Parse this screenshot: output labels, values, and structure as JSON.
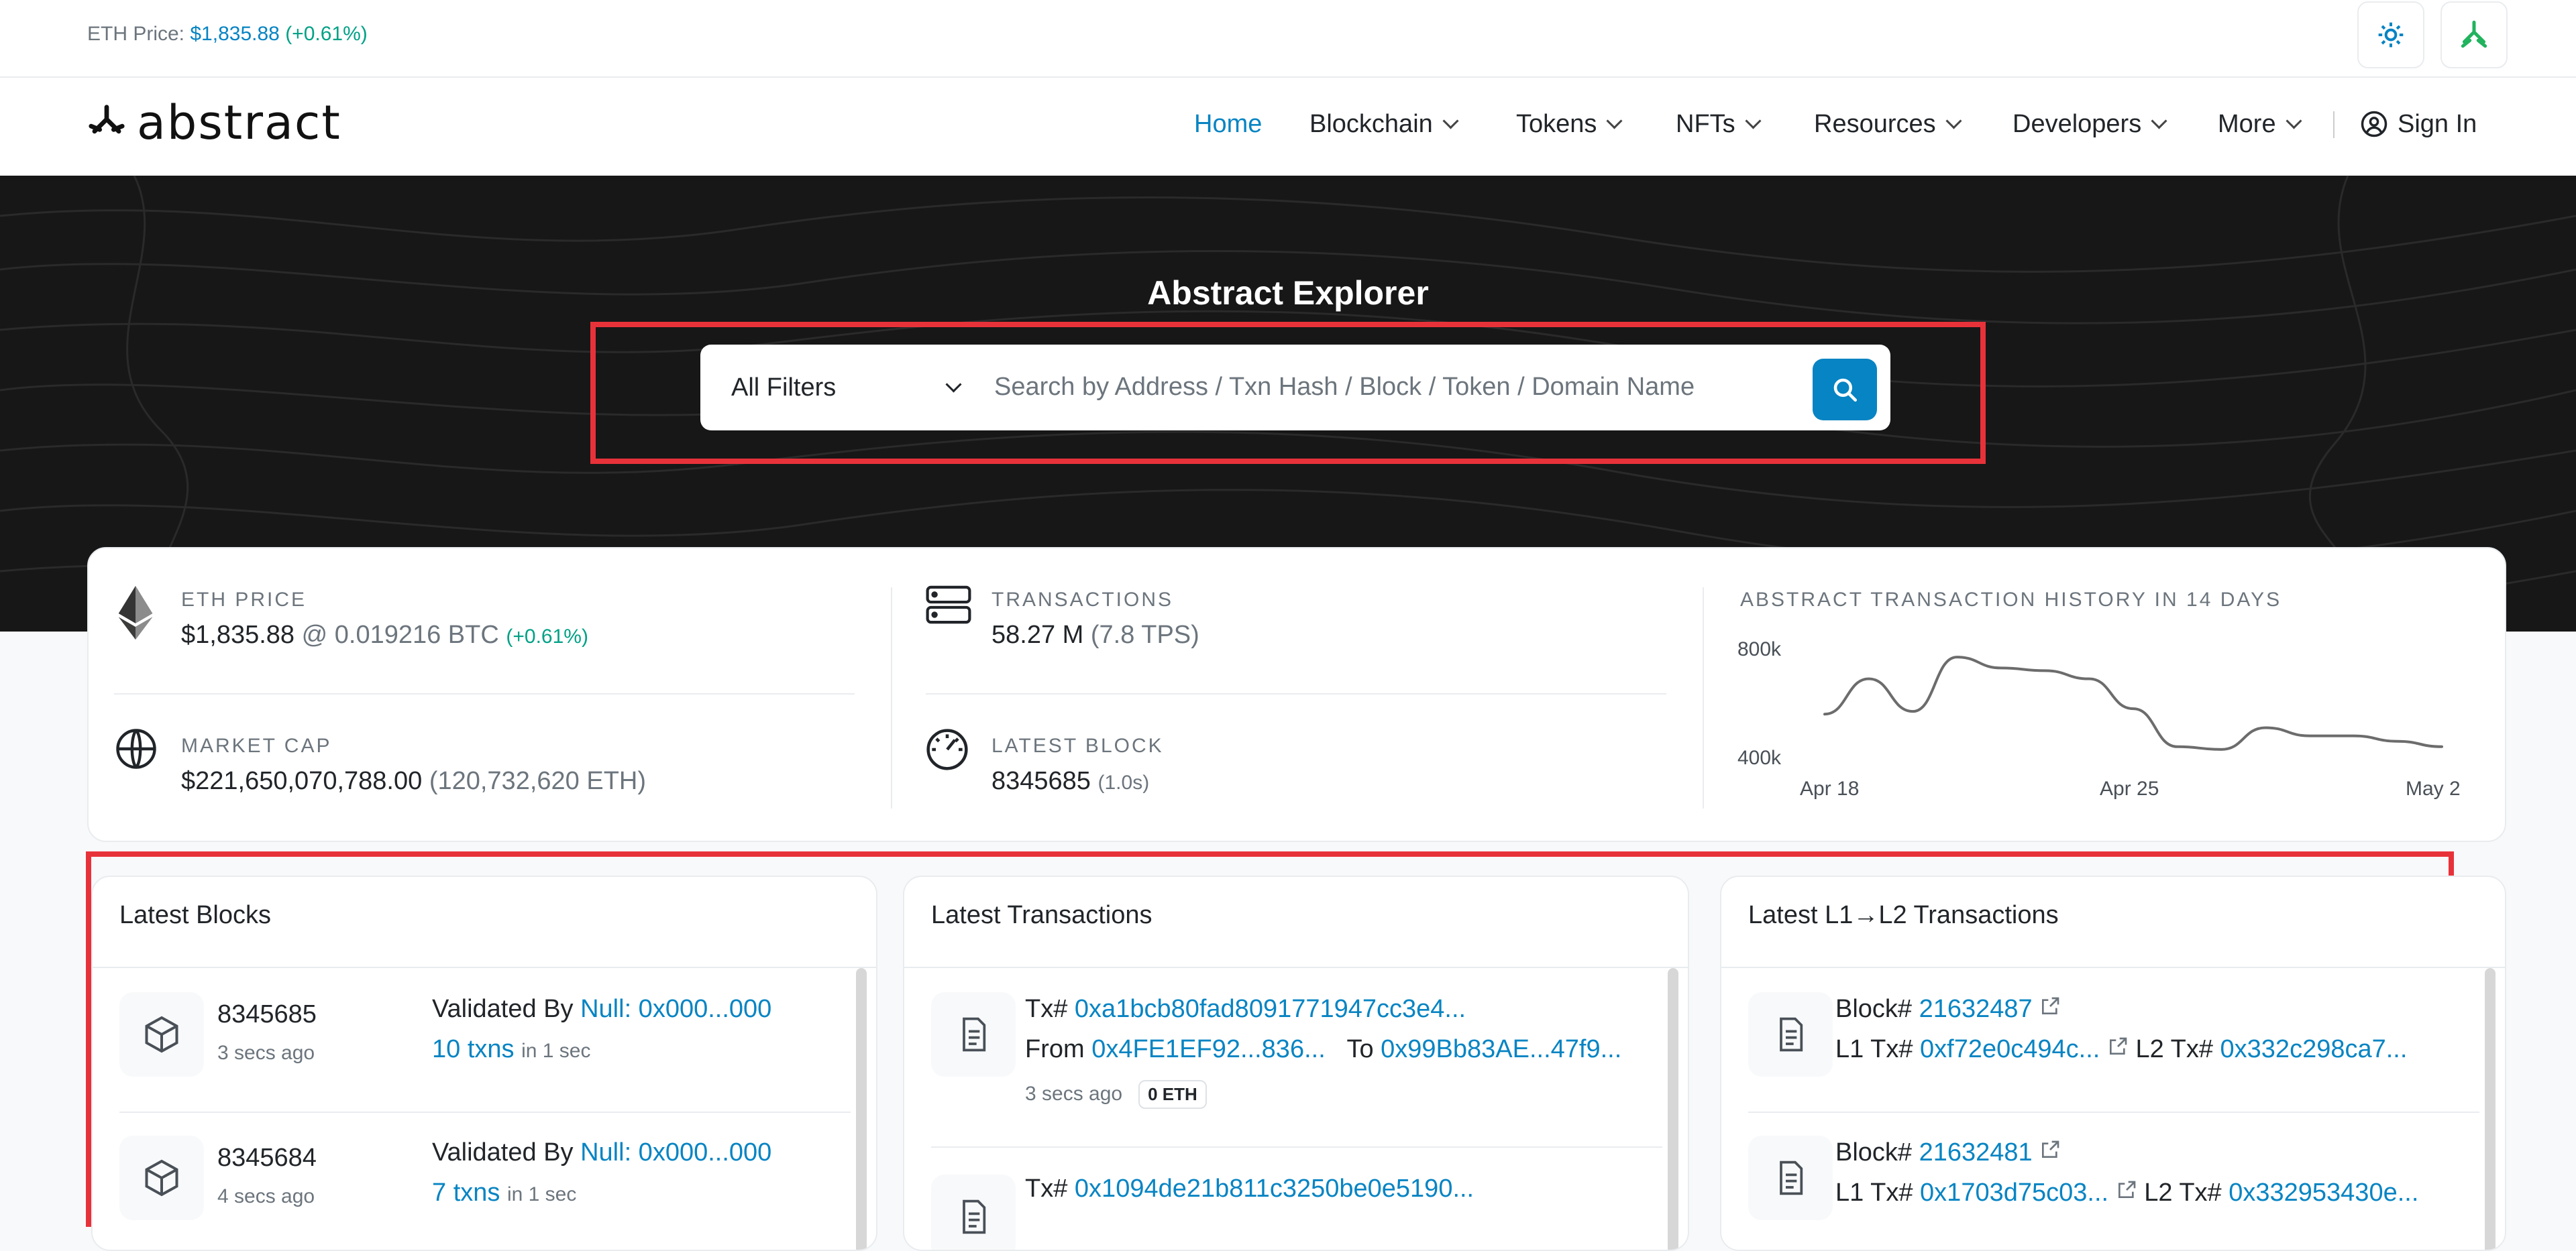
{
  "topbar": {
    "eth_price_label": "ETH Price:",
    "eth_price_value": "$1,835.88",
    "eth_price_change": "(+0.61%)"
  },
  "nav": {
    "logo_text": "abstract",
    "items": [
      "Home",
      "Blockchain",
      "Tokens",
      "NFTs",
      "Resources",
      "Developers",
      "More"
    ],
    "sign_in": "Sign In"
  },
  "hero": {
    "title": "Abstract Explorer",
    "filter_label": "All Filters",
    "search_placeholder": "Search by Address / Txn Hash / Block / Token / Domain Name"
  },
  "stats": {
    "eth_price": {
      "label": "ETH PRICE",
      "value": "$1,835.88",
      "btc": "@ 0.019216 BTC",
      "change": "(+0.61%)"
    },
    "market_cap": {
      "label": "MARKET CAP",
      "value": "$221,650,070,788.00",
      "eth": "(120,732,620 ETH)"
    },
    "transactions": {
      "label": "TRANSACTIONS",
      "value": "58.27 M",
      "tps": "(7.8 TPS)"
    },
    "latest_block": {
      "label": "LATEST BLOCK",
      "value": "8345685",
      "time": "(1.0s)"
    },
    "history": {
      "label": "ABSTRACT TRANSACTION HISTORY IN 14 DAYS"
    }
  },
  "chart_data": {
    "type": "line",
    "title": "ABSTRACT TRANSACTION HISTORY IN 14 DAYS",
    "x": [
      "Apr 18",
      "Apr 19",
      "Apr 20",
      "Apr 21",
      "Apr 22",
      "Apr 23",
      "Apr 24",
      "Apr 25",
      "Apr 26",
      "Apr 27",
      "Apr 28",
      "Apr 29",
      "Apr 30",
      "May 1",
      "May 2"
    ],
    "xticks": [
      "Apr 18",
      "Apr 25",
      "May 2"
    ],
    "yticks": [
      "800k",
      "400k"
    ],
    "ylim": [
      400000,
      800000
    ],
    "values": [
      560000,
      690000,
      570000,
      770000,
      730000,
      720000,
      690000,
      580000,
      440000,
      430000,
      510000,
      480000,
      480000,
      460000,
      440000
    ]
  },
  "blocks": {
    "title": "Latest Blocks",
    "rows": [
      {
        "number": "8345685",
        "age": "3 secs ago",
        "validated_label": "Validated By",
        "validator": "Null: 0x000...000",
        "txns": "10 txns",
        "time": "in 1 sec"
      },
      {
        "number": "8345684",
        "age": "4 secs ago",
        "validated_label": "Validated By",
        "validator": "Null: 0x000...000",
        "txns": "7 txns",
        "time": "in 1 sec"
      }
    ]
  },
  "transactions": {
    "title": "Latest Transactions",
    "rows": [
      {
        "tx_label": "Tx#",
        "hash": "0xa1bcb80fad8091771947cc3e4...",
        "from_label": "From",
        "from": "0x4FE1EF92...836...",
        "to_label": "To",
        "to": "0x99Bb83AE...47f9...",
        "age": "3 secs ago",
        "value": "0 ETH"
      },
      {
        "tx_label": "Tx#",
        "hash": "0x1094de21b811c3250be0e5190..."
      }
    ]
  },
  "l1l2": {
    "title": "Latest L1→L2 Transactions",
    "rows": [
      {
        "block_label": "Block#",
        "block": "21632487",
        "l1_label": "L1 Tx#",
        "l1": "0xf72e0c494c...",
        "l2_label": "L2 Tx#",
        "l2": "0x332c298ca7..."
      },
      {
        "block_label": "Block#",
        "block": "21632481",
        "l1_label": "L1 Tx#",
        "l1": "0x1703d75c03...",
        "l2_label": "L2 Tx#",
        "l2": "0x332953430e..."
      }
    ]
  },
  "colors": {
    "accent": "#0784c3",
    "positive": "#00a186",
    "highlight": "#e8323a",
    "hero_bg": "#171717"
  }
}
